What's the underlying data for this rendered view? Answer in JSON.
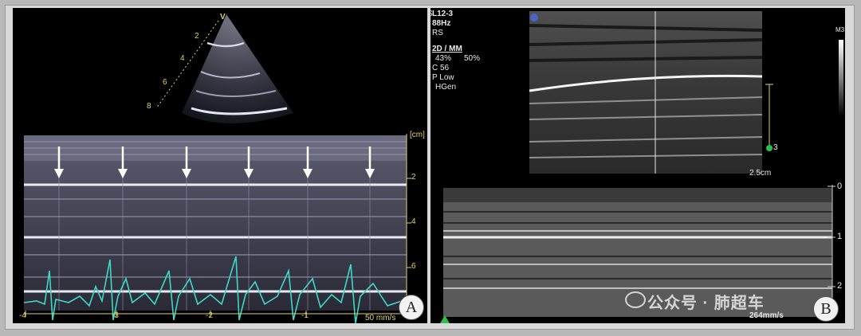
{
  "panel_a": {
    "label": "A",
    "sector_marker": "V",
    "sector_depths": [
      "2",
      "4",
      "6",
      "8"
    ],
    "mmode_unit": "[cm]",
    "mmode_depths": [
      "2",
      "4",
      "6"
    ],
    "time_ticks": [
      "-4",
      "-3",
      "-2",
      "-1"
    ],
    "sweep_speed": "50 mm/s",
    "arrow_count": 6
  },
  "panel_b": {
    "label": "B",
    "probe": "L12-3",
    "frequency": "88Hz",
    "mode_rs": "RS",
    "mode": "2D / MM",
    "gain": "43%",
    "dynamic": "50%",
    "compression": "C 56",
    "power": "P Low",
    "harmonics": "HGen",
    "corner_flag": "S",
    "depth_label": "2.5cm",
    "focus_number": "3",
    "colorbar_label": "M3",
    "mmode_depths": [
      "0",
      "1",
      "2"
    ],
    "sweep_speed": "264mm/s"
  },
  "watermark": {
    "text": "公众号 · 肺超车"
  },
  "colors": {
    "ecg_trace": "#3fd8c8",
    "scale_yellow": "#e0d070",
    "focus_green": "#2fbf4f"
  }
}
